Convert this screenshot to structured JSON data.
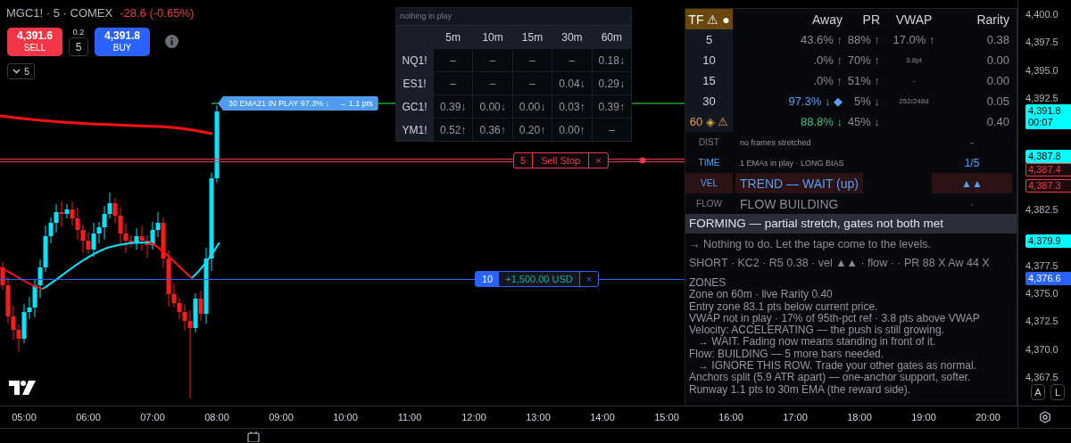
{
  "header": {
    "symbol": "MGC1! · 5 · COMEX",
    "change": "-28.6 (-0.65%)"
  },
  "trade": {
    "sell_price": "4,391.6",
    "sell_label": "SELL",
    "step": "0.2",
    "quantity": "5",
    "buy_price": "4,391.8",
    "buy_label": "BUY"
  },
  "interval": {
    "value": "5"
  },
  "ema_tag": {
    "text": "30 EMA21  IN PLAY  97.3% ↓",
    "target": "→ 1.1 pts"
  },
  "orders": [
    {
      "kind": "stop",
      "quantity": "5",
      "label": "Sell Stop",
      "close": "×"
    },
    {
      "kind": "position",
      "quantity": "10",
      "label": "+1,500.00 USD",
      "close": "×"
    }
  ],
  "correlation": {
    "title": "nothing in play",
    "columns": [
      "5m",
      "10m",
      "15m",
      "30m",
      "60m"
    ],
    "rows": [
      {
        "symbol": "NQ1!",
        "cells": [
          "–",
          "–",
          "–",
          "–",
          "0.18↓"
        ]
      },
      {
        "symbol": "ES1!",
        "cells": [
          "–",
          "–",
          "–",
          "0.04↓",
          "0.29↓"
        ]
      },
      {
        "symbol": "GC1!",
        "cells": [
          "0.39↓",
          "0.00↓",
          "0.00↓",
          "0.03↑",
          "0.39↑"
        ]
      },
      {
        "symbol": "YM1!",
        "cells": [
          "0.52↑",
          "0.36↑",
          "0.20↑",
          "0.00↑",
          "–"
        ]
      }
    ]
  },
  "panel": {
    "header": [
      "TF ⚠ ●",
      "Away",
      "PR",
      "VWAP",
      "Rarity"
    ],
    "rows": [
      {
        "tf": "5",
        "kind": "plain",
        "away": "43.6% ↑",
        "pr": "88% ↑",
        "vwap": {
          "text": "17.0% ↑",
          "kind": "value"
        },
        "rarity": "0.38"
      },
      {
        "tf": "10",
        "kind": "plain",
        "away": ".0% ↑",
        "pr": "70% ↑",
        "vwap": {
          "text": "3.8pt",
          "kind": "note"
        },
        "rarity": "0.00"
      },
      {
        "tf": "15",
        "kind": "plain",
        "away": ".0% ↑",
        "pr": "51% ↑",
        "vwap": {
          "text": "-",
          "kind": "note"
        },
        "rarity": "0.00"
      },
      {
        "tf": "30",
        "kind": "touch",
        "away": "97.3% ↓ ◆",
        "pr": "5% ↓",
        "vwap": {
          "text": "252/248d",
          "kind": "note"
        },
        "rarity": "0.05"
      },
      {
        "tf": "60 ◈ ⚠",
        "kind": "zone",
        "away": "88.8% ↓",
        "pr": "45% ↓",
        "rarity": "0.40"
      }
    ],
    "gates": [
      {
        "label": "DIST",
        "text": "no frames stretched",
        "value": "-",
        "active": false,
        "kind": "detail",
        "alert": false
      },
      {
        "label": "TIME",
        "text": "1 EMAs in play · LONG BIAS",
        "value": "1/5",
        "active": true,
        "kind": "detail",
        "alert": false
      },
      {
        "label": "VEL",
        "text": "TREND — WAIT  (up)",
        "value": "▲▲",
        "active": true,
        "kind": "headline",
        "alert": true
      },
      {
        "label": "FLOW",
        "text": "FLOW BUILDING",
        "value": "·",
        "active": false,
        "kind": "headline",
        "alert": false
      }
    ],
    "status": "FORMING — partial stretch, gates not both met",
    "advice": "→ Nothing to do. Let the tape come to the levels.",
    "summary": "SHORT · KC2 · R5 0.38 · vel ▲▲ · flow · · PR 88 X  Aw 44 X",
    "zones_title": "ZONES",
    "zones": [
      {
        "text": "Zone on 60m · live Rarity 0.40",
        "kind": "line"
      },
      {
        "text": "Entry zone 83.1 pts below current price.",
        "kind": "line"
      },
      {
        "text": "VWAP not in play · 17% of 95th-pct ref · 3.8 pts above VWAP",
        "kind": "line"
      },
      {
        "text": "Velocity: ACCELERATING — the push is still growing.",
        "kind": "line"
      },
      {
        "text": "→ WAIT. Fading now means standing in front of it.",
        "kind": "indent"
      },
      {
        "text": "Flow: BUILDING — 5 more bars needed.",
        "kind": "line"
      },
      {
        "text": "→ IGNORE THIS ROW. Trade your other gates as normal.",
        "kind": "indent"
      },
      {
        "text": "Anchors split (5.9 ATR apart) — one-anchor support, softer.",
        "kind": "line"
      },
      {
        "text": "Runway 1.1 pts to 30m EMA (the reward side).",
        "kind": "line"
      }
    ]
  },
  "price_axis": {
    "ticks": [
      "4,400.0",
      "4,397.5",
      "4,395.0",
      "4,392.5",
      "4,382.5",
      "4,377.5",
      "4,375.0",
      "4,372.5",
      "4,370.0",
      "4,367.5"
    ],
    "labels": [
      {
        "text": "4,391.8",
        "countdown": "00:07",
        "kind": "filled",
        "color": "#00ffff"
      },
      {
        "text": "4,387.8",
        "kind": "filled",
        "color": "#00ffff"
      },
      {
        "text": "4,387.4",
        "kind": "outlined",
        "color": "#f23645"
      },
      {
        "text": "4,387.3",
        "kind": "outlined",
        "color": "#f23645"
      },
      {
        "text": "4,379.9",
        "kind": "filled",
        "color": "#00ffff"
      },
      {
        "text": "4,376.6",
        "kind": "filled",
        "color": "#2962ff"
      }
    ],
    "scale_buttons": [
      "A",
      "L"
    ]
  },
  "time_axis": [
    "05:00",
    "06:00",
    "07:00",
    "08:00",
    "09:00",
    "10:00",
    "11:00",
    "12:00",
    "13:00",
    "14:00",
    "15:00",
    "16:00",
    "17:00",
    "18:00",
    "19:00",
    "20:00"
  ]
}
